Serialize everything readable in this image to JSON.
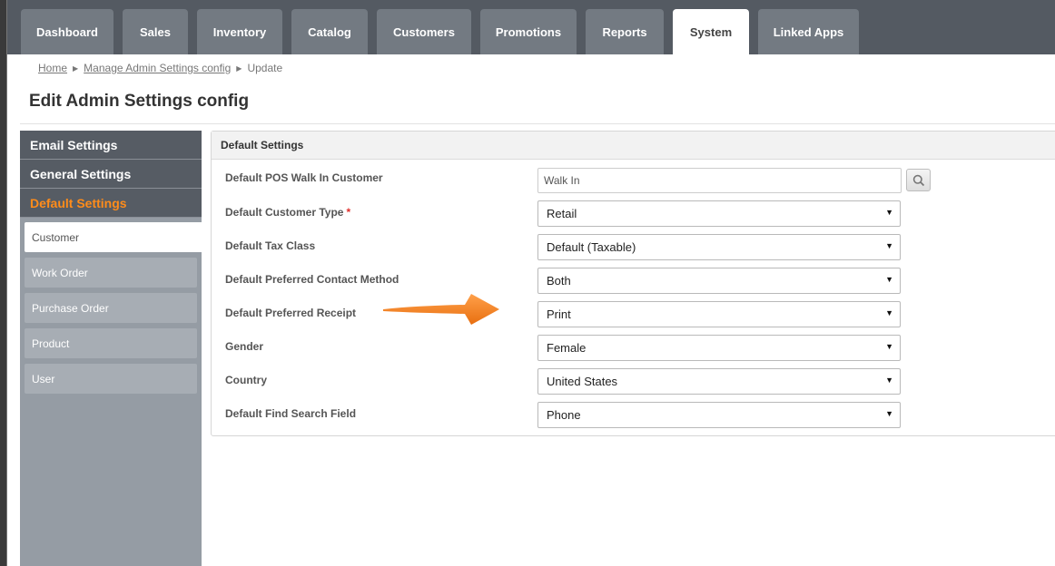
{
  "nav": {
    "tabs": [
      {
        "label": "Dashboard"
      },
      {
        "label": "Sales"
      },
      {
        "label": "Inventory"
      },
      {
        "label": "Catalog"
      },
      {
        "label": "Customers"
      },
      {
        "label": "Promotions"
      },
      {
        "label": "Reports"
      },
      {
        "label": "System"
      },
      {
        "label": "Linked Apps"
      }
    ],
    "active_tab": "System"
  },
  "breadcrumb": {
    "home": "Home",
    "manage": "Manage Admin Settings config",
    "current": "Update"
  },
  "page_title": "Edit Admin Settings config",
  "sidebar": {
    "headers": [
      {
        "label": "Email Settings"
      },
      {
        "label": "General Settings"
      },
      {
        "label": "Default Settings"
      }
    ],
    "items": [
      {
        "label": "Customer"
      },
      {
        "label": "Work Order"
      },
      {
        "label": "Purchase Order"
      },
      {
        "label": "Product"
      },
      {
        "label": "User"
      }
    ]
  },
  "panel": {
    "title": "Default Settings",
    "fields": {
      "walk_in_customer": {
        "label": "Default POS Walk In Customer",
        "value": "Walk In"
      },
      "customer_type": {
        "label": "Default Customer Type",
        "required_mark": "*",
        "value": "Retail"
      },
      "tax_class": {
        "label": "Default Tax Class",
        "value": "Default (Taxable)"
      },
      "contact_method": {
        "label": "Default Preferred Contact Method",
        "value": "Both"
      },
      "receipt": {
        "label": "Default Preferred Receipt",
        "value": "Print"
      },
      "gender": {
        "label": "Gender",
        "value": "Female"
      },
      "country": {
        "label": "Country",
        "value": "United States"
      },
      "find_search_field": {
        "label": "Default Find Search Field",
        "value": "Phone"
      }
    }
  },
  "colors": {
    "nav_bg": "#545a62",
    "tab_bg": "#737a82",
    "sidebar_active": "#ff8c1a",
    "required": "#e0302c",
    "annotation_arrow": "#f58220"
  },
  "icons": {
    "search": "magnifier-icon",
    "dropdown": "triangle-down-icon",
    "breadcrumb_sep": "triangle-right-icon"
  }
}
